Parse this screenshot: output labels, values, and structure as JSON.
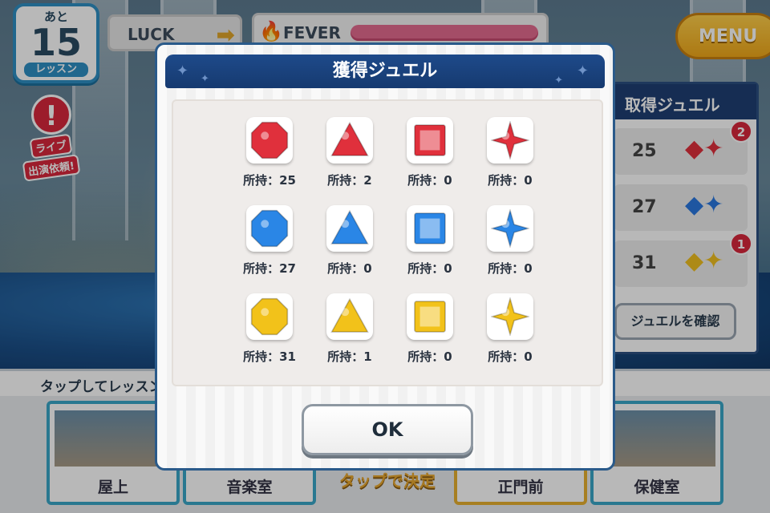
{
  "hud": {
    "counter_prefix": "あと",
    "counter_value": "15",
    "counter_suffix": "レッスン",
    "luck_label": "LUCK",
    "fever_label": "FEVER",
    "menu_label": "MENU",
    "live_badge_line1": "ライブ",
    "live_badge_line2": "出演依頼!"
  },
  "side_panel": {
    "title": "取得ジュエル",
    "rows": [
      {
        "count": "25",
        "badge": "2",
        "color": "#e0303c"
      },
      {
        "count": "27",
        "badge": "",
        "color": "#2a78e0"
      },
      {
        "count": "31",
        "badge": "1",
        "color": "#f0c020"
      }
    ],
    "check_button": "ジュエルを確認"
  },
  "bottom": {
    "tap_message": "タップしてレッスン",
    "tap_decide": "タップで決定",
    "locations": [
      "屋上",
      "音楽室",
      "正門前",
      "保健室"
    ]
  },
  "modal": {
    "title": "獲得ジュエル",
    "ok_label": "OK",
    "colors": {
      "red": "#e0303c",
      "blue": "#2a86e6",
      "yellow": "#f2c21a"
    },
    "gems": [
      {
        "shape": "octagon",
        "color": "red",
        "owned": "所持：25"
      },
      {
        "shape": "triangle",
        "color": "red",
        "owned": "所持：2"
      },
      {
        "shape": "square",
        "color": "red",
        "owned": "所持：0"
      },
      {
        "shape": "star",
        "color": "red",
        "owned": "所持：0"
      },
      {
        "shape": "octagon",
        "color": "blue",
        "owned": "所持：27"
      },
      {
        "shape": "triangle",
        "color": "blue",
        "owned": "所持：0"
      },
      {
        "shape": "square",
        "color": "blue",
        "owned": "所持：0"
      },
      {
        "shape": "star",
        "color": "blue",
        "owned": "所持：0"
      },
      {
        "shape": "octagon",
        "color": "yellow",
        "owned": "所持：31"
      },
      {
        "shape": "triangle",
        "color": "yellow",
        "owned": "所持：1"
      },
      {
        "shape": "square",
        "color": "yellow",
        "owned": "所持：0"
      },
      {
        "shape": "star",
        "color": "yellow",
        "owned": "所持：0"
      }
    ]
  }
}
